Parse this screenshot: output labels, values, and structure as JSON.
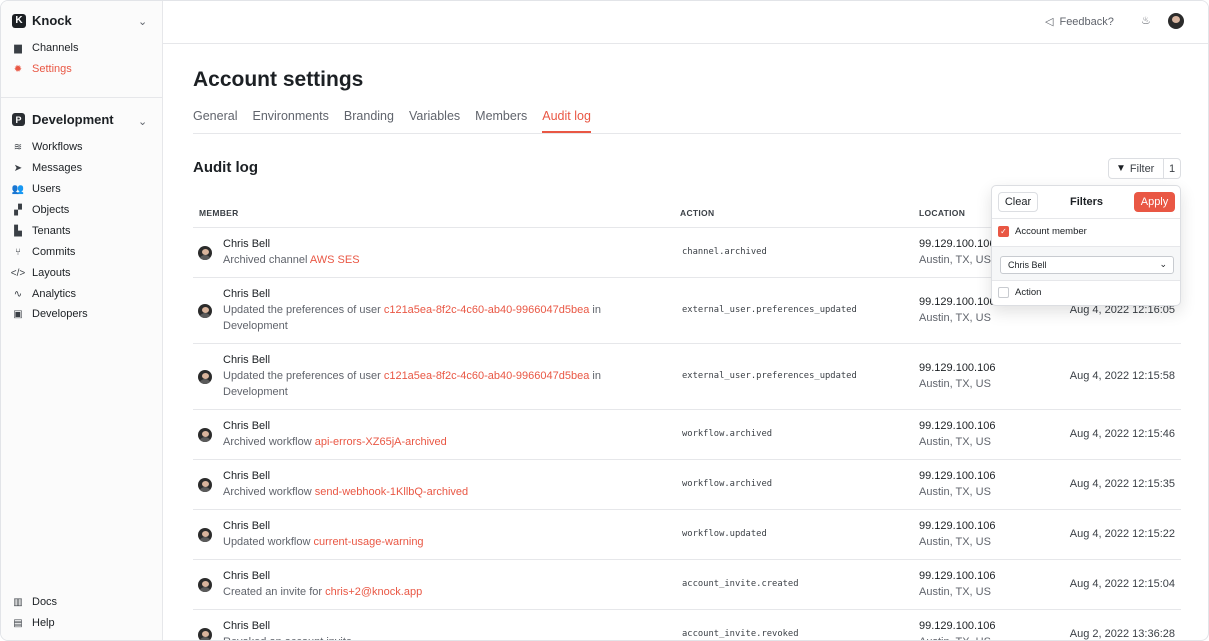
{
  "sidebar": {
    "brand": {
      "logo": "K",
      "name": "Knock"
    },
    "top_items": [
      {
        "label": "Channels",
        "icon": "channels-icon",
        "glyph": "▆"
      },
      {
        "label": "Settings",
        "icon": "gear-icon",
        "glyph": "✹",
        "active": true
      }
    ],
    "env": {
      "logo": "P",
      "name": "Development"
    },
    "env_items": [
      {
        "label": "Workflows",
        "icon": "workflows-icon",
        "glyph": "≋"
      },
      {
        "label": "Messages",
        "icon": "send-icon",
        "glyph": "➤"
      },
      {
        "label": "Users",
        "icon": "users-icon",
        "glyph": "👥"
      },
      {
        "label": "Objects",
        "icon": "objects-icon",
        "glyph": "▞"
      },
      {
        "label": "Tenants",
        "icon": "tenants-icon",
        "glyph": "▙"
      },
      {
        "label": "Commits",
        "icon": "commits-icon",
        "glyph": "⑂"
      },
      {
        "label": "Layouts",
        "icon": "code-icon",
        "glyph": "</>"
      },
      {
        "label": "Analytics",
        "icon": "analytics-icon",
        "glyph": "∿"
      },
      {
        "label": "Developers",
        "icon": "terminal-icon",
        "glyph": "▣"
      }
    ],
    "bottom_items": [
      {
        "label": "Docs",
        "icon": "book-icon",
        "glyph": "▥"
      },
      {
        "label": "Help",
        "icon": "chat-icon",
        "glyph": "▤"
      }
    ]
  },
  "topbar": {
    "feedback": "Feedback?"
  },
  "page": {
    "title": "Account settings",
    "tabs": [
      "General",
      "Environments",
      "Branding",
      "Variables",
      "Members",
      "Audit log"
    ],
    "active_tab": "Audit log"
  },
  "audit": {
    "title": "Audit log",
    "filter_label": "Filter",
    "filter_count": "1",
    "headers": {
      "member": "MEMBER",
      "action": "ACTION",
      "location": "LOCATION"
    },
    "rows": [
      {
        "name": "Chris Bell",
        "desc": "Archived channel ",
        "link": "AWS SES",
        "suffix": "",
        "desc2": "",
        "action": "channel.archived",
        "ip": "99.129.100.106",
        "city": "Austin, TX, US",
        "time": ""
      },
      {
        "name": "Chris Bell",
        "desc": "Updated the preferences of user ",
        "link": "c121a5ea-8f2c-4c60-ab40-9966047d5bea",
        "suffix": " in",
        "desc2": "Development",
        "action": "external_user.preferences_updated",
        "ip": "99.129.100.106",
        "city": "Austin, TX, US",
        "time": "Aug 4, 2022 12:16:05"
      },
      {
        "name": "Chris Bell",
        "desc": "Updated the preferences of user ",
        "link": "c121a5ea-8f2c-4c60-ab40-9966047d5bea",
        "suffix": " in",
        "desc2": "Development",
        "action": "external_user.preferences_updated",
        "ip": "99.129.100.106",
        "city": "Austin, TX, US",
        "time": "Aug 4, 2022 12:15:58"
      },
      {
        "name": "Chris Bell",
        "desc": "Archived workflow ",
        "link": "api-errors-XZ65jA-archived",
        "suffix": "",
        "desc2": "",
        "action": "workflow.archived",
        "ip": "99.129.100.106",
        "city": "Austin, TX, US",
        "time": "Aug 4, 2022 12:15:46"
      },
      {
        "name": "Chris Bell",
        "desc": "Archived workflow ",
        "link": "send-webhook-1KllbQ-archived",
        "suffix": "",
        "desc2": "",
        "action": "workflow.archived",
        "ip": "99.129.100.106",
        "city": "Austin, TX, US",
        "time": "Aug 4, 2022 12:15:35"
      },
      {
        "name": "Chris Bell",
        "desc": "Updated workflow ",
        "link": "current-usage-warning",
        "suffix": "",
        "desc2": "",
        "action": "workflow.updated",
        "ip": "99.129.100.106",
        "city": "Austin, TX, US",
        "time": "Aug 4, 2022 12:15:22"
      },
      {
        "name": "Chris Bell",
        "desc": "Created an invite for ",
        "link": "chris+2@knock.app",
        "suffix": "",
        "desc2": "",
        "action": "account_invite.created",
        "ip": "99.129.100.106",
        "city": "Austin, TX, US",
        "time": "Aug 4, 2022 12:15:04"
      },
      {
        "name": "Chris Bell",
        "desc": "Revoked an account invite",
        "link": "",
        "suffix": "",
        "desc2": "",
        "action": "account_invite.revoked",
        "ip": "99.129.100.106",
        "city": "Austin, TX, US",
        "time": "Aug 2, 2022 13:36:28"
      }
    ]
  },
  "filters_popover": {
    "clear": "Clear",
    "title": "Filters",
    "apply": "Apply",
    "options": [
      {
        "label": "Account member",
        "checked": true
      },
      {
        "label": "Action",
        "checked": false
      }
    ],
    "member_select": "Chris Bell",
    "accent": "#e95744"
  }
}
